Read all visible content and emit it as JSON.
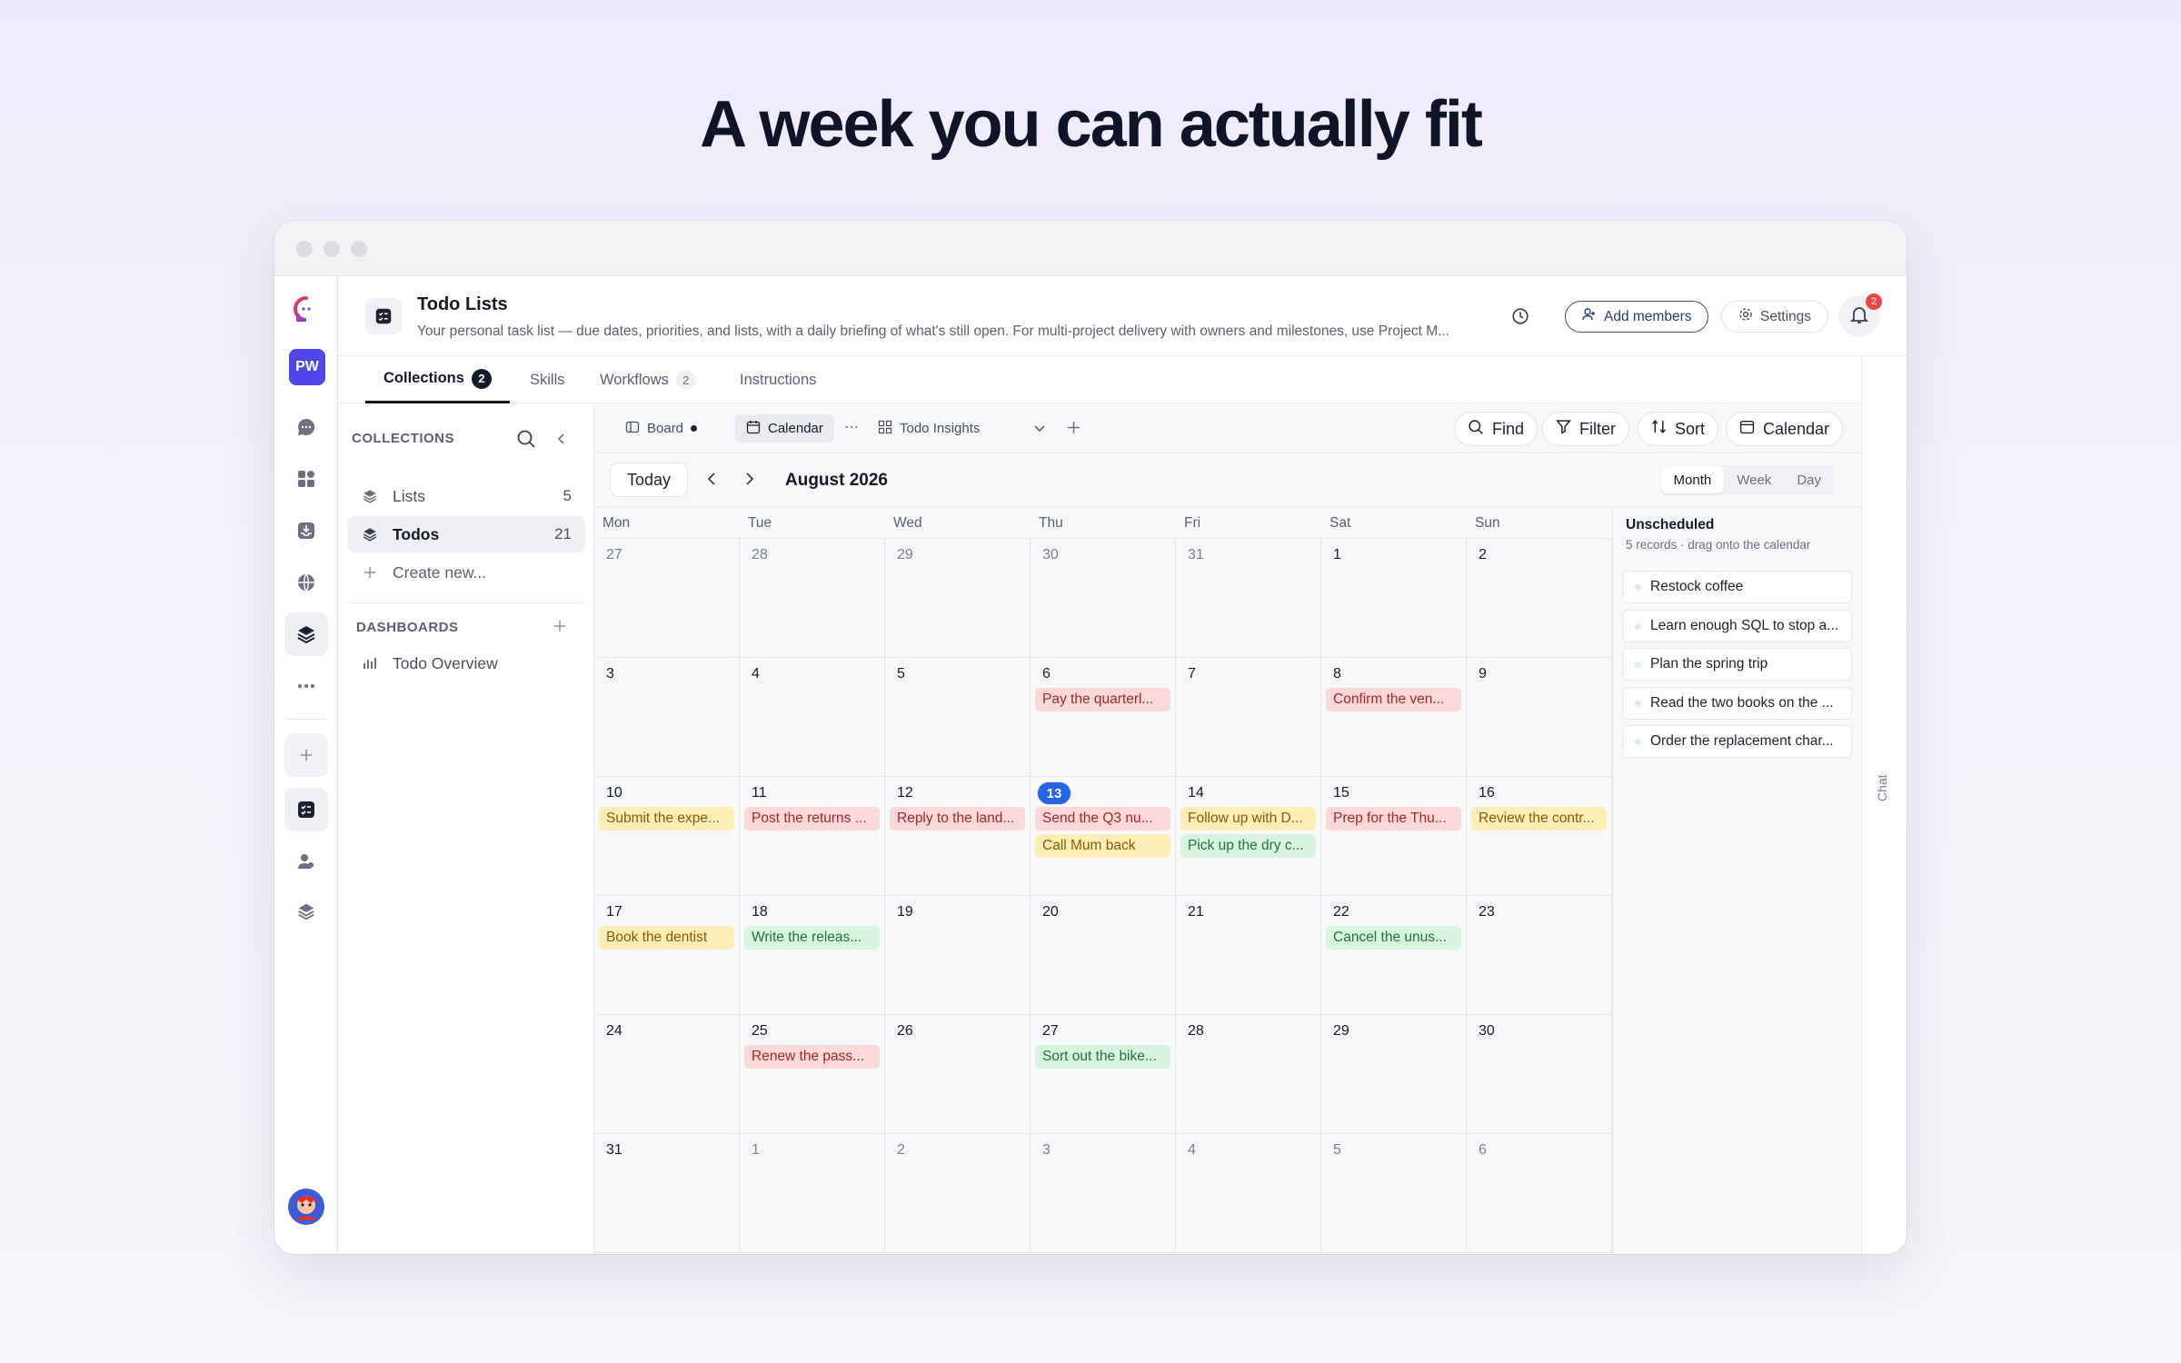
{
  "headline": "A week you can actually fit",
  "rail": {
    "user_initials": "PW"
  },
  "header": {
    "title": "Todo Lists",
    "description": "Your personal task list — due dates, priorities, and lists, with a daily briefing of what's still open. For multi-project delivery with owners and milestones, use Project M...",
    "add_members": "Add members",
    "settings": "Settings",
    "notification_count": "2"
  },
  "tabs": [
    {
      "label": "Collections",
      "count": "2"
    },
    {
      "label": "Skills",
      "count": ""
    },
    {
      "label": "Workflows",
      "count": "2"
    },
    {
      "label": "Instructions",
      "count": ""
    }
  ],
  "sidebar": {
    "collections_heading": "COLLECTIONS",
    "items": [
      {
        "label": "Lists",
        "count": "5"
      },
      {
        "label": "Todos",
        "count": "21"
      },
      {
        "label": "Create new...",
        "count": ""
      }
    ],
    "dashboards_heading": "DASHBOARDS",
    "dashboards": [
      {
        "label": "Todo Overview"
      }
    ]
  },
  "toolbar": {
    "views": [
      "Board",
      "Calendar",
      "Todo Insights"
    ],
    "find": "Find",
    "filter": "Filter",
    "sort": "Sort",
    "calendar": "Calendar"
  },
  "calendar": {
    "today_label": "Today",
    "month_title": "August 2026",
    "modes": [
      "Month",
      "Week",
      "Day"
    ],
    "active_mode": "Month",
    "weekdays": [
      "Mon",
      "Tue",
      "Wed",
      "Thu",
      "Fri",
      "Sat",
      "Sun"
    ],
    "today": "13",
    "weeks": [
      [
        {
          "d": "27",
          "out": true
        },
        {
          "d": "28",
          "out": true
        },
        {
          "d": "29",
          "out": true
        },
        {
          "d": "30",
          "out": true
        },
        {
          "d": "31",
          "out": true
        },
        {
          "d": "1"
        },
        {
          "d": "2"
        }
      ],
      [
        {
          "d": "3"
        },
        {
          "d": "4"
        },
        {
          "d": "5"
        },
        {
          "d": "6",
          "events": [
            {
              "t": "Pay the quarterl...",
              "c": "red"
            }
          ]
        },
        {
          "d": "7"
        },
        {
          "d": "8",
          "events": [
            {
              "t": "Confirm the ven...",
              "c": "red"
            }
          ]
        },
        {
          "d": "9"
        }
      ],
      [
        {
          "d": "10",
          "events": [
            {
              "t": "Submit the expe...",
              "c": "yellow"
            }
          ]
        },
        {
          "d": "11",
          "events": [
            {
              "t": "Post the returns ...",
              "c": "red"
            }
          ]
        },
        {
          "d": "12",
          "events": [
            {
              "t": "Reply to the land...",
              "c": "red"
            }
          ]
        },
        {
          "d": "13",
          "events": [
            {
              "t": "Send the Q3 nu...",
              "c": "red"
            },
            {
              "t": "Call Mum back",
              "c": "yellow"
            }
          ]
        },
        {
          "d": "14",
          "events": [
            {
              "t": "Follow up with D...",
              "c": "yellow"
            },
            {
              "t": "Pick up the dry c...",
              "c": "green"
            }
          ]
        },
        {
          "d": "15",
          "events": [
            {
              "t": "Prep for the Thu...",
              "c": "red"
            }
          ]
        },
        {
          "d": "16",
          "events": [
            {
              "t": "Review the contr...",
              "c": "yellow"
            }
          ]
        }
      ],
      [
        {
          "d": "17",
          "events": [
            {
              "t": "Book the dentist",
              "c": "yellow"
            }
          ]
        },
        {
          "d": "18",
          "events": [
            {
              "t": "Write the releas...",
              "c": "green"
            }
          ]
        },
        {
          "d": "19"
        },
        {
          "d": "20"
        },
        {
          "d": "21"
        },
        {
          "d": "22",
          "events": [
            {
              "t": "Cancel the unus...",
              "c": "green"
            }
          ]
        },
        {
          "d": "23"
        }
      ],
      [
        {
          "d": "24"
        },
        {
          "d": "25",
          "events": [
            {
              "t": "Renew the pass...",
              "c": "red"
            }
          ]
        },
        {
          "d": "26"
        },
        {
          "d": "27",
          "events": [
            {
              "t": "Sort out the bike...",
              "c": "green"
            }
          ]
        },
        {
          "d": "28"
        },
        {
          "d": "29"
        },
        {
          "d": "30"
        }
      ],
      [
        {
          "d": "31"
        },
        {
          "d": "1",
          "out": true
        },
        {
          "d": "2",
          "out": true
        },
        {
          "d": "3",
          "out": true
        },
        {
          "d": "4",
          "out": true
        },
        {
          "d": "5",
          "out": true
        },
        {
          "d": "6",
          "out": true
        }
      ]
    ]
  },
  "unscheduled": {
    "title": "Unscheduled",
    "subtitle": "5 records · drag onto the calendar",
    "items": [
      "Restock coffee",
      "Learn enough SQL to stop a...",
      "Plan the spring trip",
      "Read the two books on the ...",
      "Order the replacement char..."
    ]
  },
  "chat_label": "Chat",
  "colors": {
    "accent": "#4f46e5",
    "today_blue": "#2563eb",
    "event_red": "#fdd8d8",
    "event_yellow": "#fdeeb5",
    "event_green": "#d7f4df"
  }
}
